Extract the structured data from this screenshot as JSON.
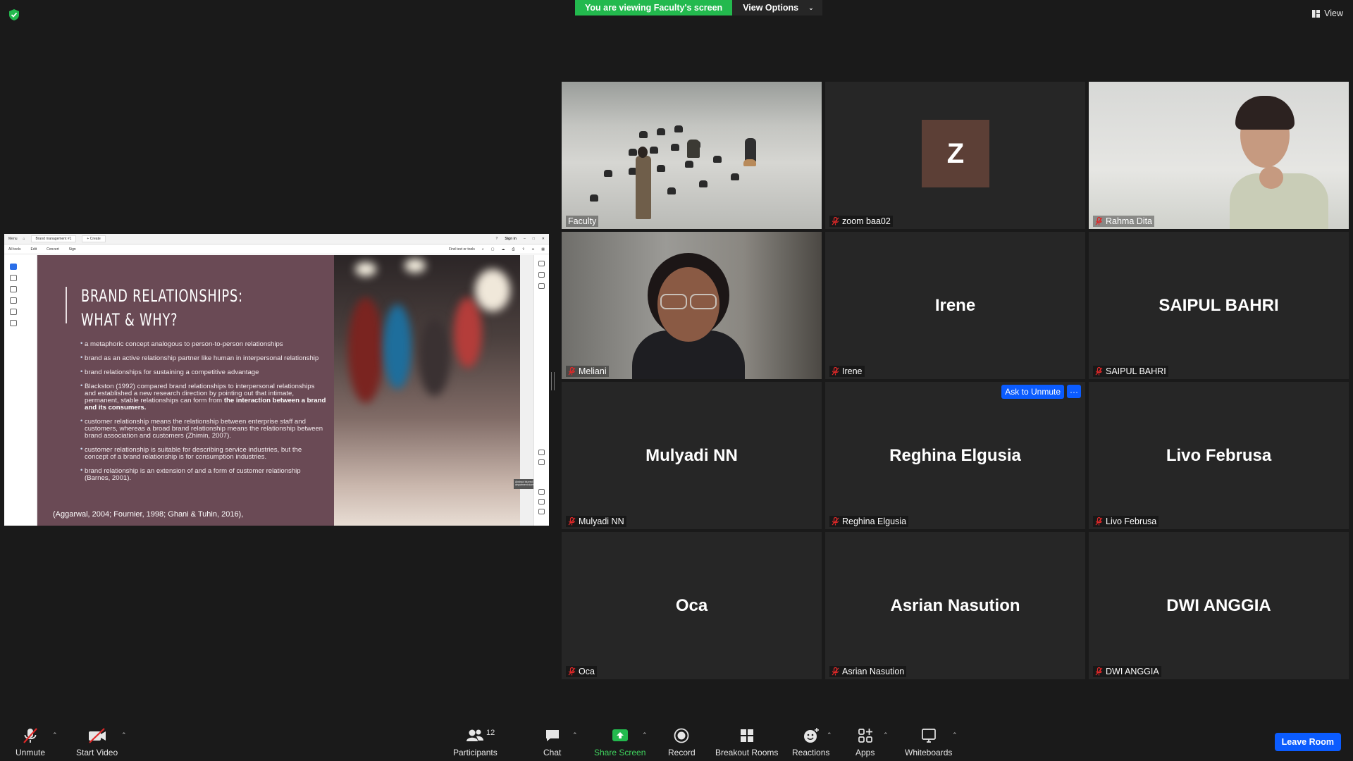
{
  "top": {
    "viewing_banner": "You are viewing Faculty's screen",
    "view_options": "View Options",
    "view": "View"
  },
  "share": {
    "tabs": {
      "menu": "Menu",
      "doc_tab": "Brand management #1",
      "create": "+ Create",
      "sign_in": "Sign in"
    },
    "menu": {
      "all_tools": "All tools",
      "edit": "Edit",
      "convert": "Convert",
      "sign": "Sign",
      "find": "Find text or tools"
    },
    "slide": {
      "title_line1": "BRAND RELATIONSHIPS:",
      "title_line2": "WHAT & WHY?",
      "bullets": [
        "a metaphoric concept analogous to person-to-person relationships",
        "brand as an active relationship partner like human in interpersonal relationship",
        "brand relationships for sustaining a competitive advantage",
        "Blackston (1992) compared brand relationships to interpersonal relationships and established a new research direction by pointing out that intimate, permanent, stable relationships can form from",
        "customer relationship means the relationship between enterprise staff and customers, whereas a broad brand relationship means the relationship between brand association and customers (Zhimin, 2007).",
        "customer relationship is suitable for describing service industries, but the concept of a brand relationship is for consumption industries.",
        "brand relationship is an extension of and a form of customer relationship (Barnes, 2001)."
      ],
      "bullet4_bold": "the interaction between a brand and its consumers.",
      "citation": "(Aggarwal, 2004; Fournier, 1998; Ghani & Tuhin, 2016),",
      "tooltip": "Abstract blurred background of department store"
    }
  },
  "participants": [
    {
      "name": "Faculty",
      "type": "video-classroom",
      "muted": false,
      "active": true
    },
    {
      "name": "zoom baa02",
      "type": "avatar",
      "initial": "Z",
      "muted": true
    },
    {
      "name": "Rahma Dita",
      "type": "video-person",
      "muted": true
    },
    {
      "name": "Meliani",
      "type": "video-person",
      "muted": true
    },
    {
      "name": "Irene",
      "display": "Irene",
      "type": "name",
      "muted": true
    },
    {
      "name": "SAIPUL BAHRI",
      "display": "SAIPUL BAHRI",
      "type": "name",
      "muted": true
    },
    {
      "name": "Mulyadi NN",
      "display": "Mulyadi NN",
      "type": "name",
      "muted": true
    },
    {
      "name": "Reghina Elgusia",
      "display": "Reghina Elgusia",
      "type": "name",
      "muted": true
    },
    {
      "name": "Livo Februsa",
      "display": "Livo Februsa",
      "type": "name",
      "muted": true
    },
    {
      "name": "Oca",
      "display": "Oca",
      "type": "name",
      "muted": true
    },
    {
      "name": "Asrian Nasution",
      "display": "Asrian Nasution",
      "type": "name",
      "muted": true
    },
    {
      "name": "DWI ANGGIA",
      "display": "DWI ANGGIA",
      "type": "name",
      "muted": true
    }
  ],
  "tile_actions": {
    "ask_to_unmute": "Ask to Unmute",
    "more": "···"
  },
  "toolbar": {
    "unmute": "Unmute",
    "start_video": "Start Video",
    "participants": "Participants",
    "participants_count": "12",
    "chat": "Chat",
    "share_screen": "Share Screen",
    "record": "Record",
    "breakout_rooms": "Breakout Rooms",
    "reactions": "Reactions",
    "apps": "Apps",
    "whiteboards": "Whiteboards",
    "leave_room": "Leave Room"
  },
  "colors": {
    "banner_green": "#23b94e",
    "share_green": "#3fd35e",
    "accent_blue": "#0b5cff",
    "active_speaker": "#d8e87a",
    "muted_red": "#e02828",
    "slide_bg": "#6a4a55"
  }
}
